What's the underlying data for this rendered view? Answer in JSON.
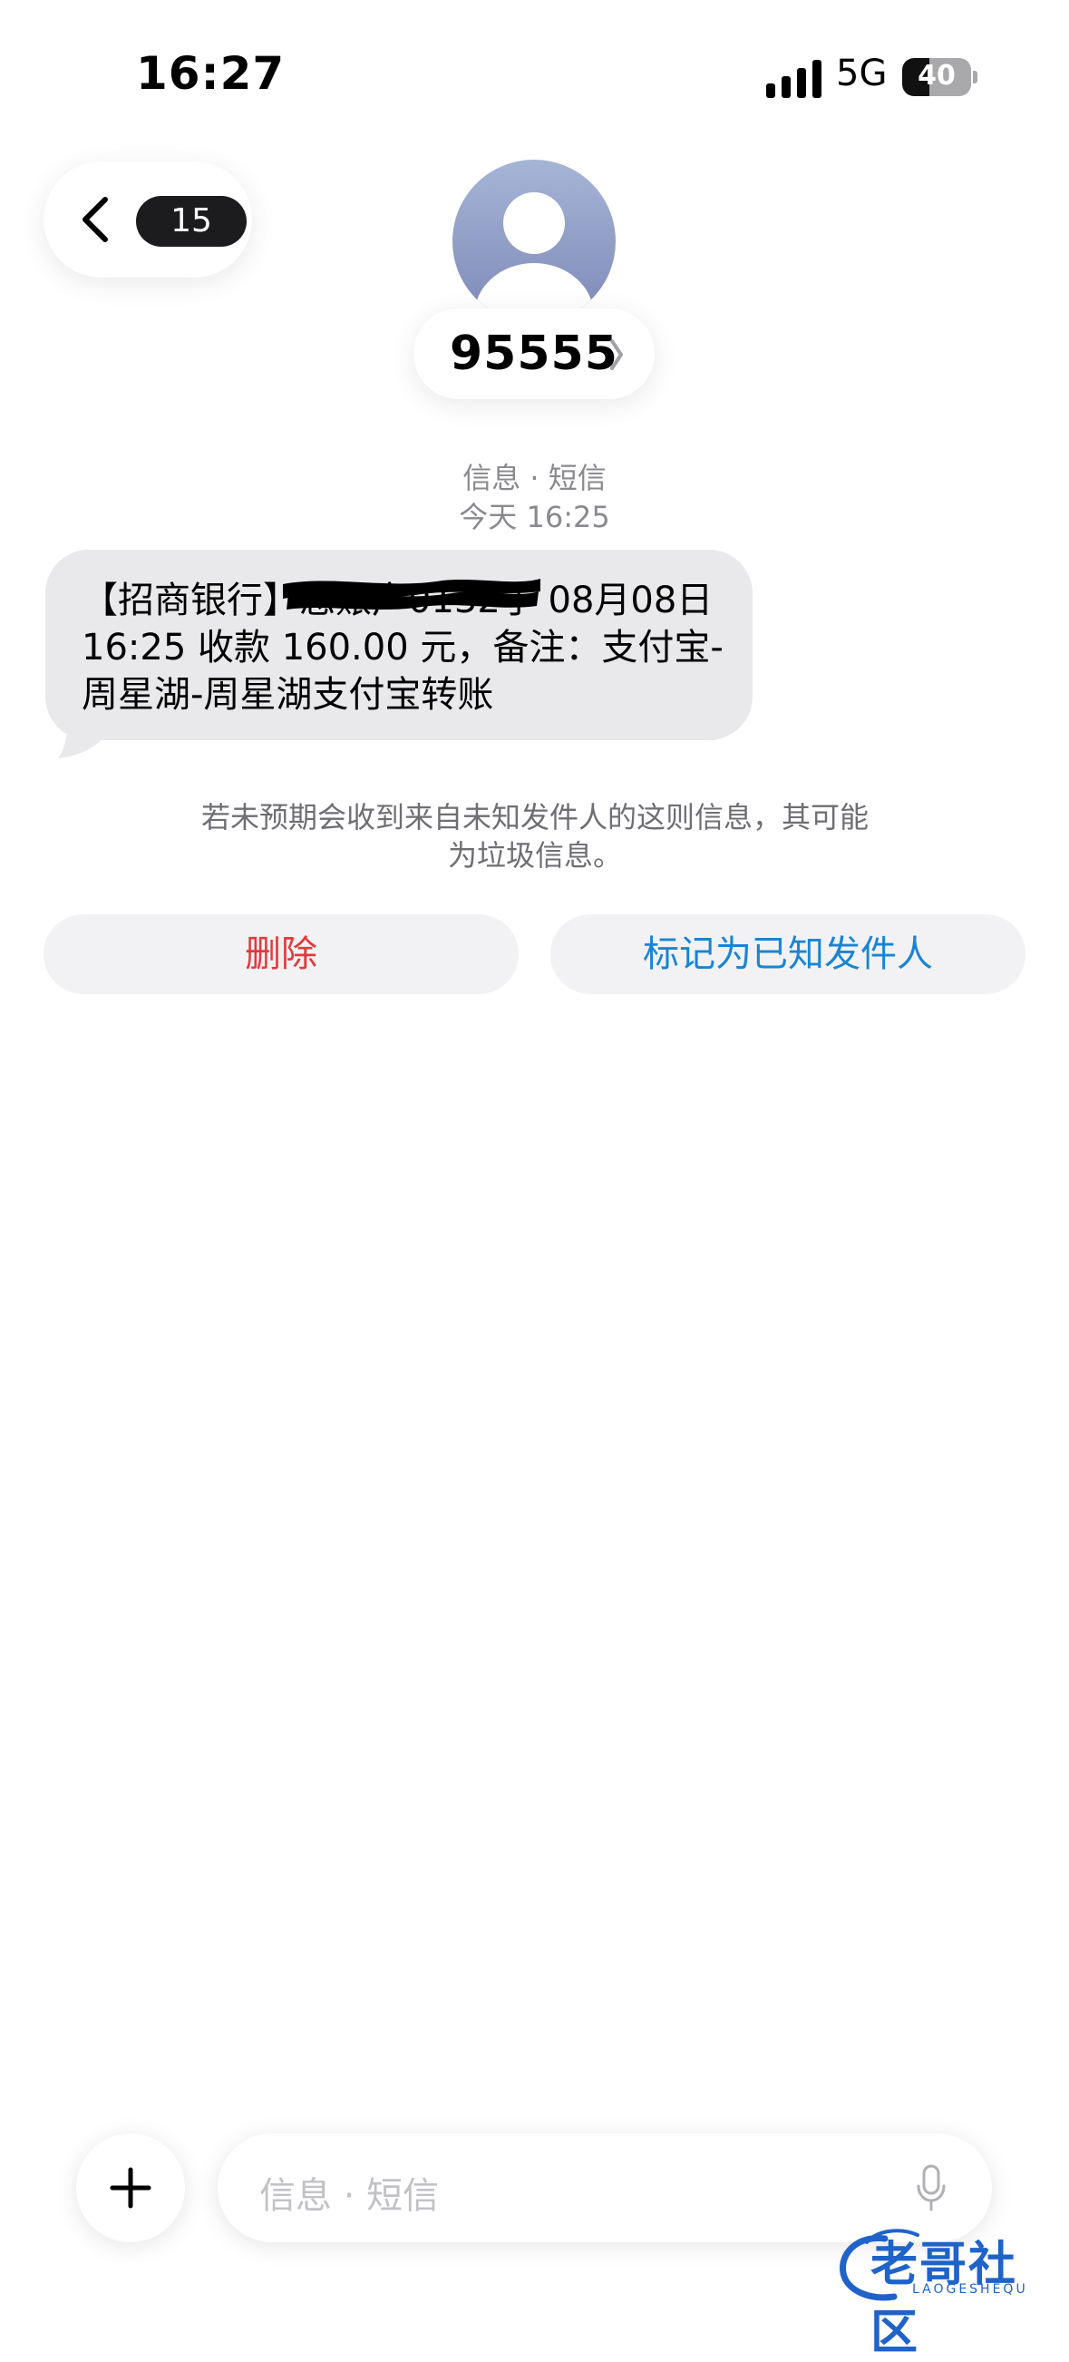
{
  "status_bar": {
    "time": "16:27",
    "network": "5G",
    "battery": "40",
    "battery_level": 0.4
  },
  "nav": {
    "back_icon": "chevron-left-icon",
    "unread_count": "15"
  },
  "contact": {
    "name": "95555",
    "avatar_icon": "person-placeholder-icon"
  },
  "conversation": {
    "service_label": "信息 · 短信",
    "timestamp": "今天 16:25",
    "message_prefix": "【招商银行】",
    "message_redacted_fragment": "您账户0132于",
    "message_line1_tail": "08月08日",
    "message_line2": "16:25 收款 160.00 元，备注：支付宝-",
    "message_line3": "周星湖-周星湖支付宝转账"
  },
  "spam_notice": {
    "line1": "若未预期会收到来自未知发件人的这则信息，其可能",
    "line2": "为垃圾信息。"
  },
  "actions": {
    "delete_label": "删除",
    "mark_known_label": "标记为已知发件人"
  },
  "composer": {
    "placeholder": "信息 · 短信",
    "add_icon": "plus-icon",
    "mic_icon": "microphone-icon"
  },
  "watermark": {
    "text": "老哥社区",
    "sub": "LAOGESHEQU"
  },
  "colors": {
    "delete": "#e5383b",
    "link": "#1a84d4",
    "bubble": "#e9e9eb",
    "meta": "#8a8a8e"
  }
}
